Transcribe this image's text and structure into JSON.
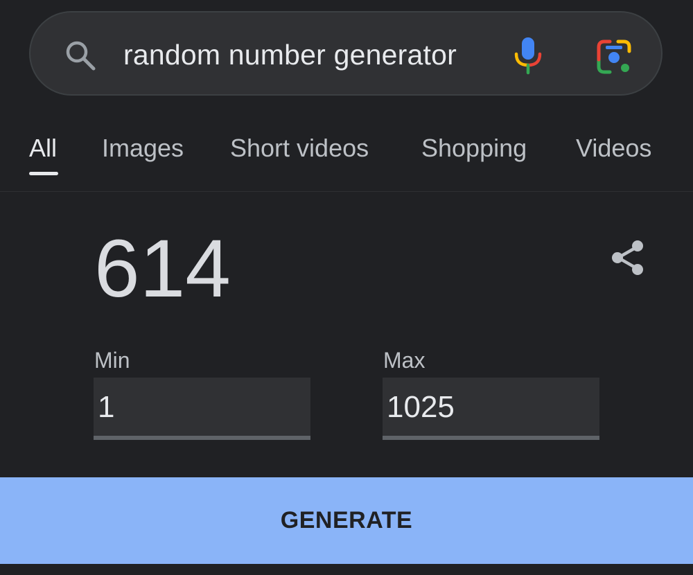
{
  "search": {
    "query": "random number generator",
    "icons": {
      "search": "search-icon",
      "voice": "mic-icon",
      "lens": "google-lens-icon"
    }
  },
  "tabs": [
    {
      "label": "All",
      "active": true
    },
    {
      "label": "Images",
      "active": false
    },
    {
      "label": "Short videos",
      "active": false
    },
    {
      "label": "Shopping",
      "active": false
    },
    {
      "label": "Videos",
      "active": false
    }
  ],
  "generator": {
    "result": "614",
    "share_icon": "share-icon",
    "min": {
      "label": "Min",
      "value": "1"
    },
    "max": {
      "label": "Max",
      "value": "1025"
    },
    "button_label": "GENERATE"
  },
  "colors": {
    "background": "#202124",
    "search_bar": "#303134",
    "accent_button": "#8ab4f8",
    "google_blue": "#4285f4",
    "google_red": "#ea4335",
    "google_yellow": "#fbbc04",
    "google_green": "#34a853"
  }
}
